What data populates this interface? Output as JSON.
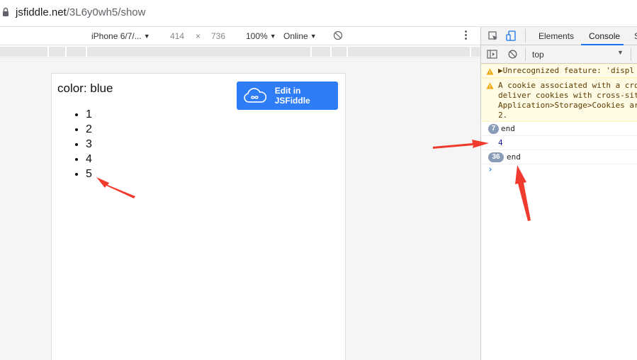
{
  "browser": {
    "url_host": "jsfiddle.net",
    "url_path": "/3L6y0wh5/show"
  },
  "device_toolbar": {
    "device": "iPhone 6/7/...",
    "width": "414",
    "times": "×",
    "height": "736",
    "zoom": "100%",
    "network": "Online"
  },
  "page": {
    "color_text": "color: blue",
    "list_items": [
      "1",
      "2",
      "3",
      "4",
      "5"
    ],
    "edit_button_label": "Edit in JSFiddle"
  },
  "devtools": {
    "tabs": [
      "Elements",
      "Console",
      "S"
    ],
    "active_tab": "Console",
    "context": "top",
    "warnings": [
      "▶Unrecognized feature: 'displ",
      "A cookie associated with a cro\ndeliver cookies with cross-sit\nApplication>Storage>Cookies ar\n2."
    ],
    "logs": [
      {
        "count": "7",
        "text": "end"
      },
      {
        "count": "",
        "text": "4"
      },
      {
        "count": "36",
        "text": "end"
      }
    ],
    "prompt": "›"
  },
  "colors": {
    "accent": "#2e7cf6",
    "devtools_active": "#1a73e8",
    "warning_bg": "#fffbe5",
    "annotation_arrow": "#f03a2e"
  }
}
